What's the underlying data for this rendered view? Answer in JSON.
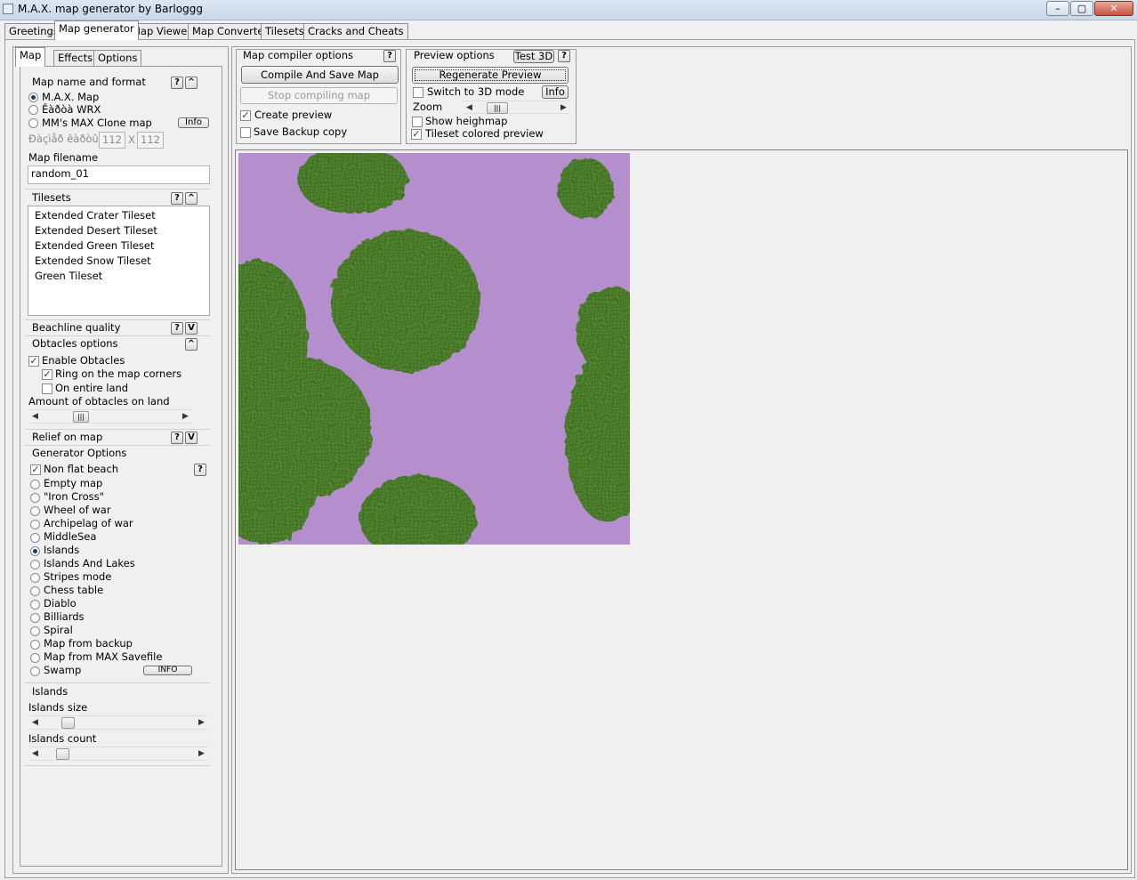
{
  "window": {
    "title": "M.A.X. map generator by Barloggg"
  },
  "main_tabs": [
    "Greetings",
    "Map generator",
    "Map Viewer",
    "Map Converter",
    "Tilesets",
    "Cracks and Cheats"
  ],
  "sub_tabs": [
    "Map",
    "Effects",
    "Options"
  ],
  "map_name_format": {
    "title": "Map name and format",
    "options": [
      "M.A.X. Map",
      "Êàðòà WRX",
      "MM's MAX Clone map"
    ],
    "info_label": "Info",
    "size_label": "Ðàçìåð êàðòû",
    "width": "112",
    "height": "112",
    "size_separator": "X",
    "filename_label": "Map filename",
    "filename_value": "random_01"
  },
  "tilesets": {
    "title": "Tilesets",
    "items": [
      "Extended Crater Tileset",
      "Extended Desert Tileset",
      "Extended Green Tileset",
      "Extended Snow Tileset",
      "Green Tileset"
    ]
  },
  "beachline": {
    "title": "Beachline quality"
  },
  "obstacles": {
    "title": "Obtacles options",
    "enable": "Enable Obtacles",
    "ring": "Ring on the map corners",
    "entire": "On entire land",
    "amount_label": "Amount of obtacles on land"
  },
  "relief": {
    "title": "Relief on map"
  },
  "generator": {
    "title": "Generator Options",
    "non_flat_beach": "Non flat beach",
    "modes": [
      "Empty map",
      "\"Iron Cross\"",
      "Wheel of war",
      "Archipelag of war",
      "MiddleSea",
      "Islands",
      "Islands And Lakes",
      "Stripes mode",
      "Chess table",
      "Diablo",
      "Billiards",
      "Spiral",
      "Map from backup",
      "Map from MAX Savefile",
      "Swamp"
    ],
    "selected": "Islands",
    "info_label": "INFO"
  },
  "islands": {
    "title": "Islands",
    "size_label": "Islands size",
    "count_label": "Islands count",
    "size_value": 0.25,
    "count_value": 0.16
  },
  "compiler": {
    "title": "Map compiler options",
    "compile_button": "Compile And Save Map",
    "stop_button": "Stop compiling map",
    "create_preview": "Create preview",
    "save_backup": "Save Backup copy"
  },
  "preview_options": {
    "title": "Preview options",
    "test3d": "Test 3D",
    "regenerate": "Regenerate Preview",
    "switch3d": "Switch to 3D mode",
    "info": "Info",
    "zoom": "Zoom",
    "show_heightmap": "Show heighmap",
    "tileset_colored": "Tileset colored preview"
  },
  "help_glyph": "?",
  "collapse_glyph": "^",
  "expand_glyph": "V",
  "colors": {
    "water": "#b58fcd",
    "land": "#4a7a2a"
  }
}
